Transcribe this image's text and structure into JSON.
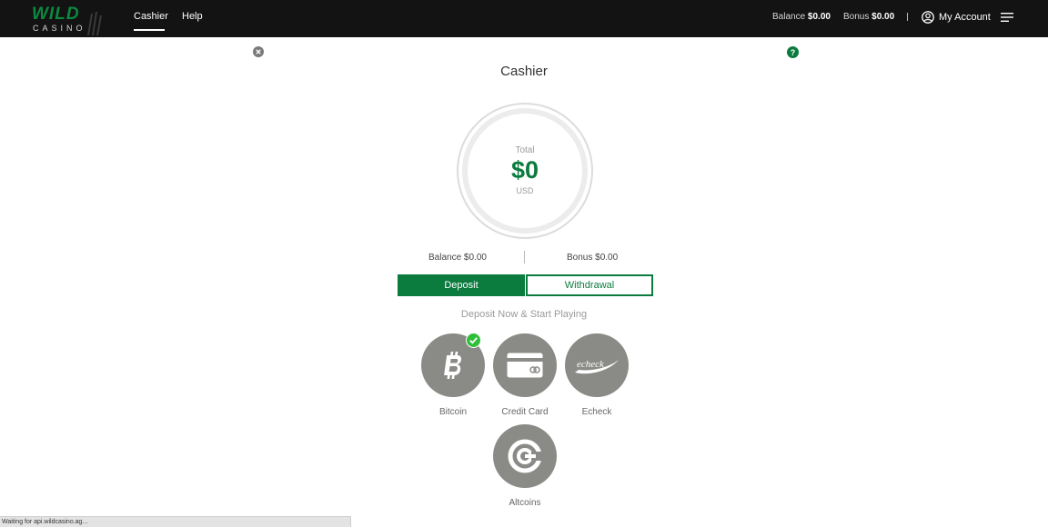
{
  "header": {
    "logo": {
      "line1": "WILD",
      "line2": "CASINO"
    },
    "nav": [
      {
        "label": "Cashier",
        "active": true
      },
      {
        "label": "Help",
        "active": false
      }
    ],
    "balance": {
      "label": "Balance",
      "value": "$0.00"
    },
    "bonus": {
      "label": "Bonus",
      "value": "$0.00"
    },
    "separator": "|",
    "account_label": "My Account",
    "icons": [
      "user-circle-icon",
      "hamburger-menu-icon"
    ]
  },
  "page": {
    "title": "Cashier",
    "close_icon": "close-circle-icon",
    "help_icon": "question-circle-icon",
    "help_glyph": "?"
  },
  "total": {
    "label": "Total",
    "amount": "$0",
    "currency": "USD"
  },
  "balances": {
    "balance": "Balance $0.00",
    "bonus": "Bonus $0.00"
  },
  "tabs": {
    "deposit": "Deposit",
    "withdrawal": "Withdrawal",
    "active": "Deposit"
  },
  "subtitle": "Deposit Now & Start Playing",
  "methods": [
    {
      "label": "Bitcoin",
      "icon": "bitcoin-icon",
      "selected": true
    },
    {
      "label": "Credit Card",
      "icon": "credit-card-icon",
      "selected": false
    },
    {
      "label": "Echeck",
      "icon": "echeck-icon",
      "icon_text": "echeck",
      "selected": false
    },
    {
      "label": "Altcoins",
      "icon": "altcoins-icon",
      "selected": false
    }
  ],
  "status_bar": "Waiting for api.wildcasino.ag...",
  "colors": {
    "topbar": "#131313",
    "brand_green": "#0b7b3e",
    "method_grey": "#8a8a87",
    "check_green": "#2fbf3a"
  }
}
